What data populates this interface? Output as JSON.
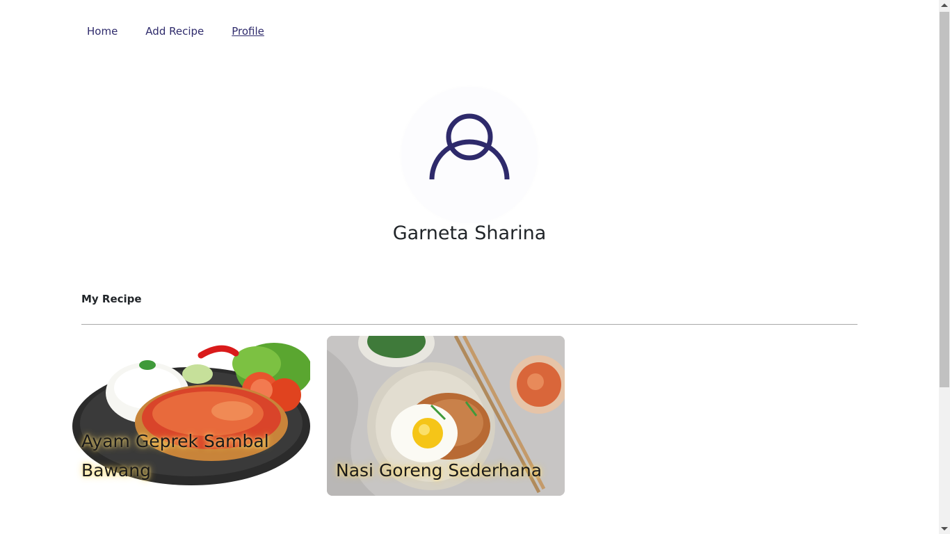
{
  "nav": {
    "items": [
      {
        "label": "Home"
      },
      {
        "label": "Add Recipe"
      },
      {
        "label": "Profile"
      }
    ]
  },
  "profile": {
    "name": "Garneta Sharina",
    "avatar_icon": "user-icon"
  },
  "section": {
    "title": "My Recipe"
  },
  "recipes": [
    {
      "title": "Ayam Geprek Sambal Bawang",
      "image": "fried-chicken-plate"
    },
    {
      "title": "Nasi Goreng Sederhana",
      "image": "fried-rice-bowl"
    }
  ],
  "colors": {
    "accent": "#2e2a6b",
    "divider": "#a8a8a8"
  }
}
